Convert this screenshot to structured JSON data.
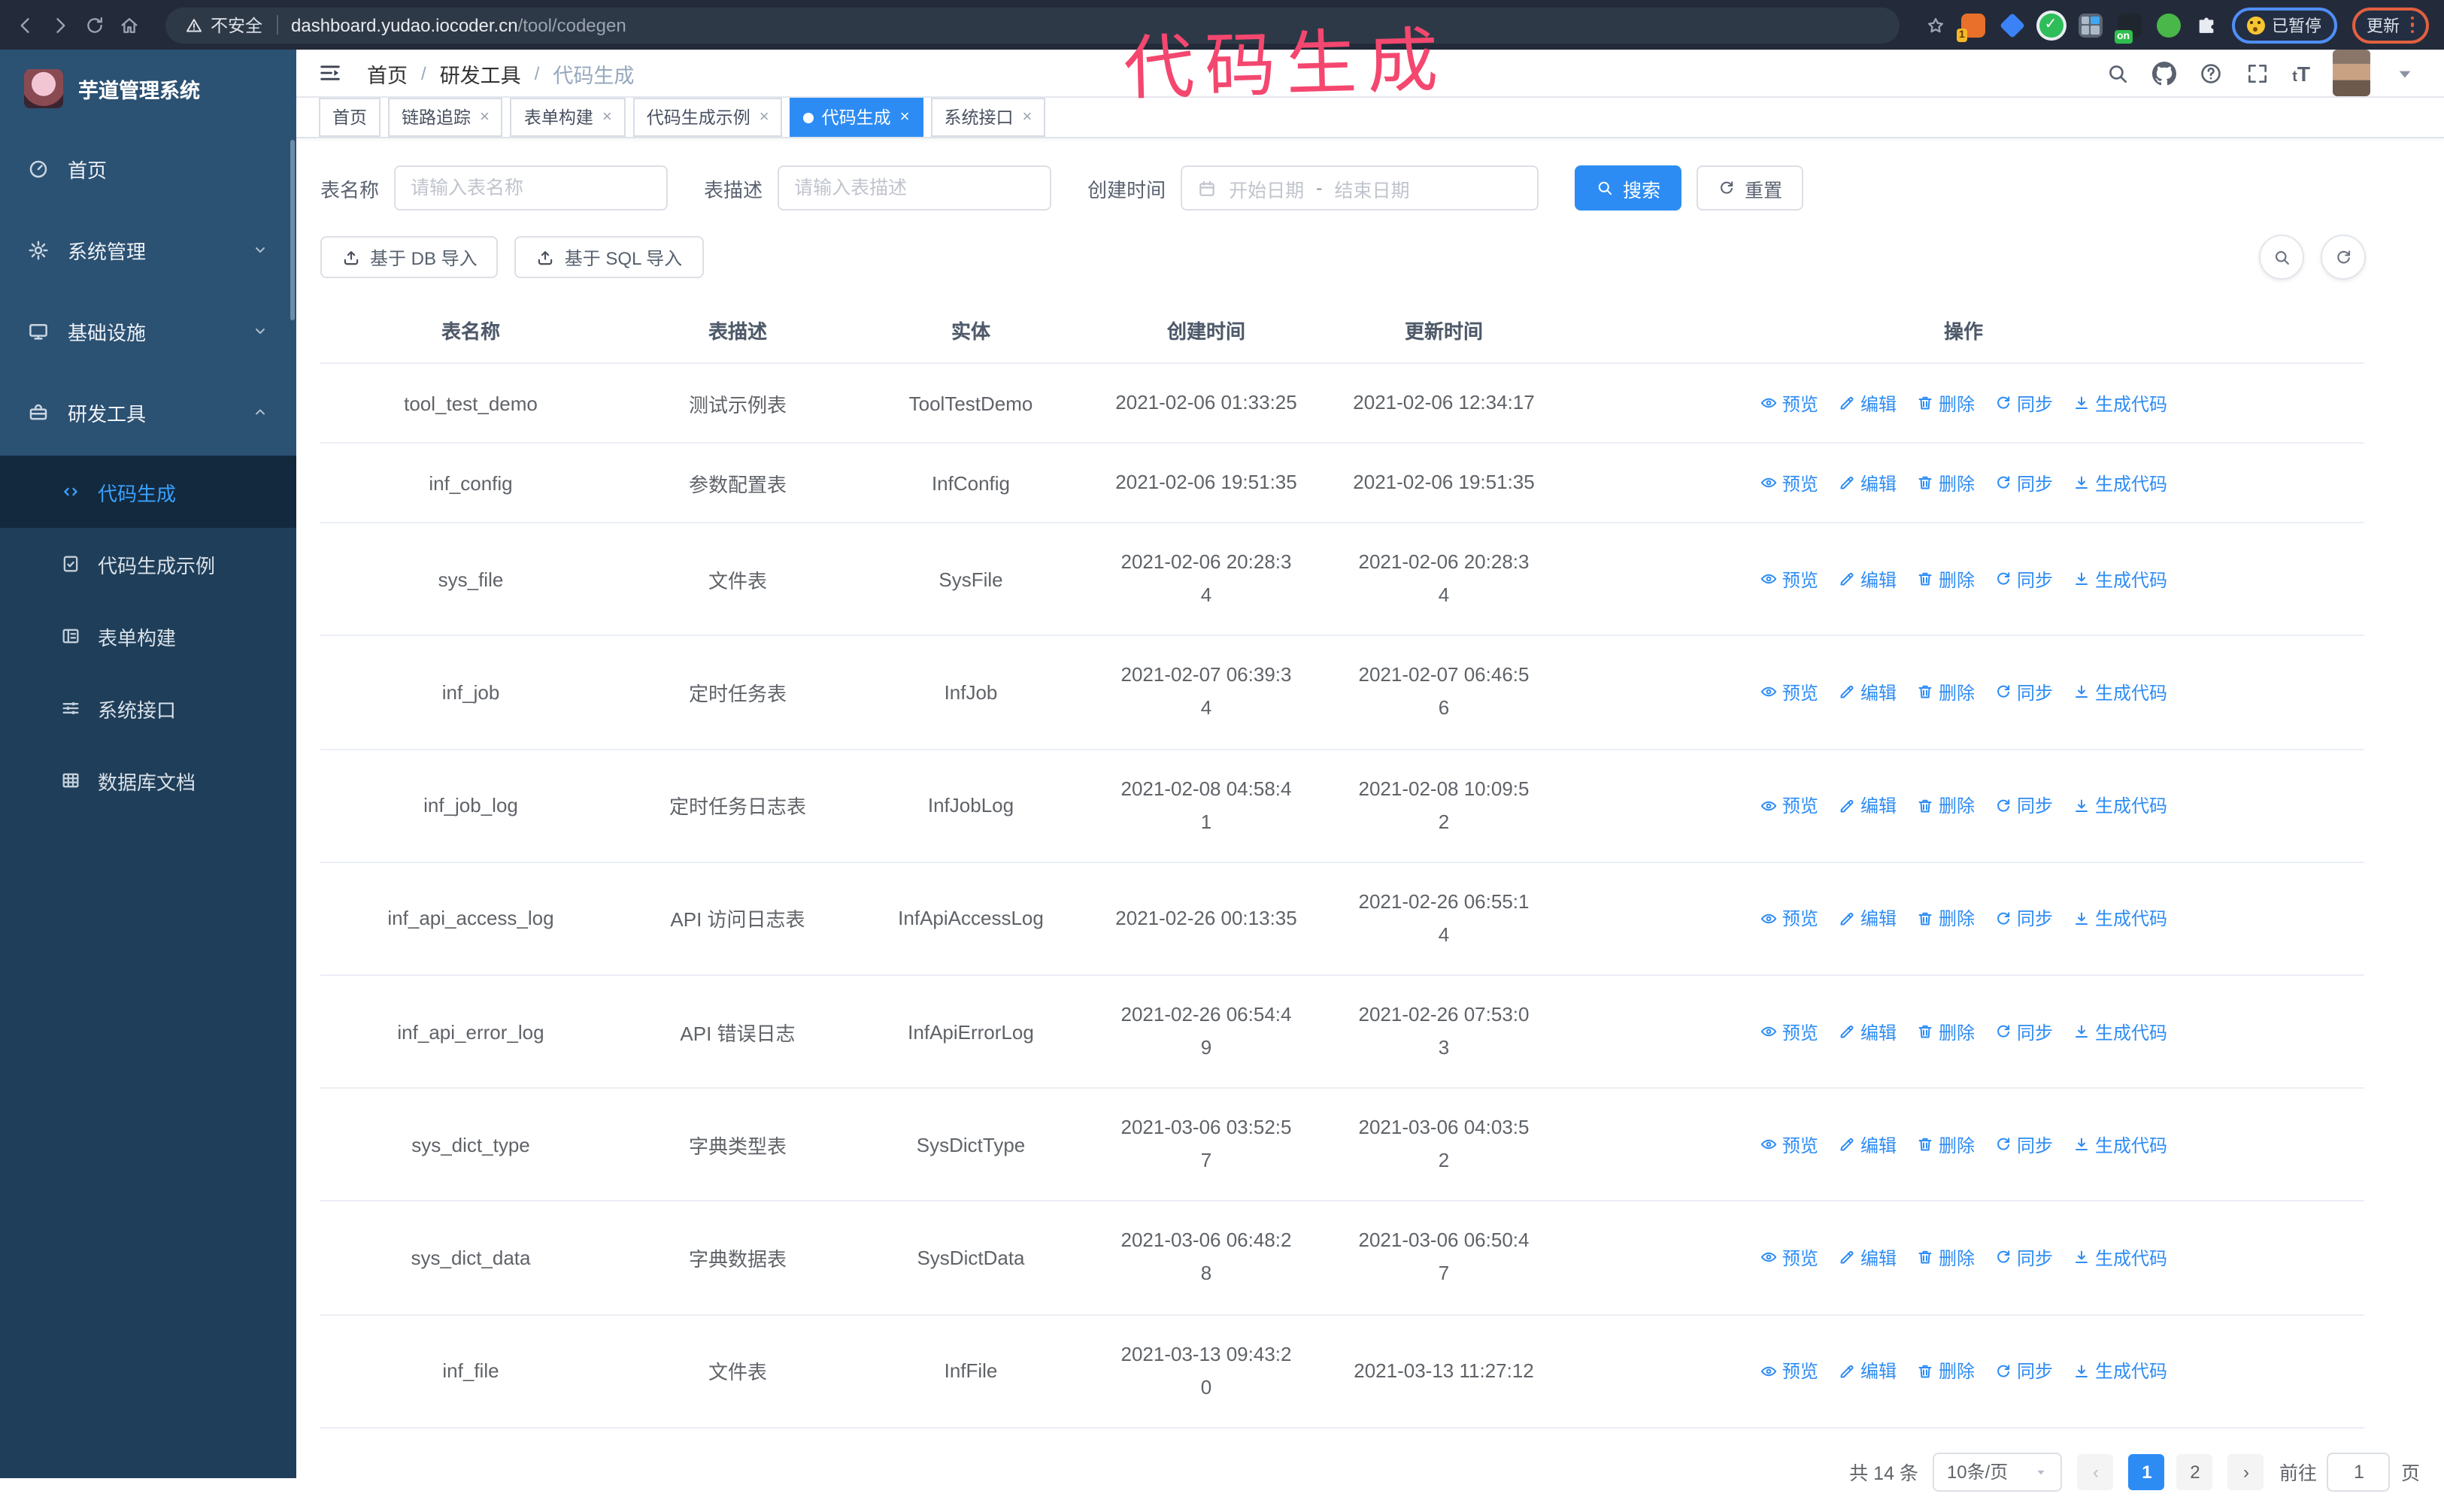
{
  "annotation": {
    "text": "代码生成",
    "color": "#f4476f"
  },
  "browser": {
    "security": "不安全",
    "url_host": "dashboard.yudao.iocoder.cn",
    "url_path": "/tool/codegen",
    "ext_badge": "1",
    "onetab": "on",
    "paused": "已暂停",
    "update": "更新"
  },
  "sidebar": {
    "title": "芋道管理系统",
    "items": [
      {
        "label": "首页",
        "icon": "dashboard-icon",
        "chevron": ""
      },
      {
        "label": "系统管理",
        "icon": "gear-icon",
        "chevron": "down"
      },
      {
        "label": "基础设施",
        "icon": "monitor-icon",
        "chevron": "down"
      },
      {
        "label": "研发工具",
        "icon": "toolbox-icon",
        "chevron": "up"
      }
    ],
    "submenu": [
      {
        "label": "代码生成",
        "icon": "code-icon",
        "active": true
      },
      {
        "label": "代码生成示例",
        "icon": "example-icon",
        "active": false
      },
      {
        "label": "表单构建",
        "icon": "form-icon",
        "active": false
      },
      {
        "label": "系统接口",
        "icon": "api-icon",
        "active": false
      },
      {
        "label": "数据库文档",
        "icon": "database-icon",
        "active": false
      }
    ]
  },
  "header": {
    "breadcrumb": [
      {
        "label": "首页"
      },
      {
        "label": "研发工具"
      },
      {
        "label": "代码生成"
      }
    ]
  },
  "tabs": [
    {
      "label": "首页",
      "closable": false,
      "active": false
    },
    {
      "label": "链路追踪",
      "closable": true,
      "active": false
    },
    {
      "label": "表单构建",
      "closable": true,
      "active": false
    },
    {
      "label": "代码生成示例",
      "closable": true,
      "active": false
    },
    {
      "label": "代码生成",
      "closable": true,
      "active": true
    },
    {
      "label": "系统接口",
      "closable": true,
      "active": false
    }
  ],
  "search": {
    "name_label": "表名称",
    "name_placeholder": "请输入表名称",
    "desc_label": "表描述",
    "desc_placeholder": "请输入表描述",
    "time_label": "创建时间",
    "start_placeholder": "开始日期",
    "range_separator": "-",
    "end_placeholder": "结束日期",
    "search_button": "搜索",
    "reset_button": "重置"
  },
  "toolbar": {
    "import_db": "基于 DB 导入",
    "import_sql": "基于 SQL 导入"
  },
  "table": {
    "columns": [
      "表名称",
      "表描述",
      "实体",
      "创建时间",
      "更新时间",
      "操作"
    ],
    "actions": [
      "预览",
      "编辑",
      "删除",
      "同步",
      "生成代码"
    ],
    "action_icons": [
      "eye-icon",
      "edit-icon",
      "delete-icon",
      "sync-icon",
      "download-icon"
    ],
    "rows": [
      {
        "name": "tool_test_demo",
        "description": "测试示例表",
        "entity": "ToolTestDemo",
        "created": "2021-02-06 01:33:25",
        "updated": "2021-02-06 12:34:17"
      },
      {
        "name": "inf_config",
        "description": "参数配置表",
        "entity": "InfConfig",
        "created": "2021-02-06 19:51:35",
        "updated": "2021-02-06 19:51:35"
      },
      {
        "name": "sys_file",
        "description": "文件表",
        "entity": "SysFile",
        "created": "2021-02-06 20:28:3\n4",
        "updated": "2021-02-06 20:28:3\n4"
      },
      {
        "name": "inf_job",
        "description": "定时任务表",
        "entity": "InfJob",
        "created": "2021-02-07 06:39:3\n4",
        "updated": "2021-02-07 06:46:5\n6"
      },
      {
        "name": "inf_job_log",
        "description": "定时任务日志表",
        "entity": "InfJobLog",
        "created": "2021-02-08 04:58:4\n1",
        "updated": "2021-02-08 10:09:5\n2"
      },
      {
        "name": "inf_api_access_log",
        "description": "API 访问日志表",
        "entity": "InfApiAccessLog",
        "created": "2021-02-26 00:13:35",
        "updated": "2021-02-26 06:55:1\n4"
      },
      {
        "name": "inf_api_error_log",
        "description": "API 错误日志",
        "entity": "InfApiErrorLog",
        "created": "2021-02-26 06:54:4\n9",
        "updated": "2021-02-26 07:53:0\n3"
      },
      {
        "name": "sys_dict_type",
        "description": "字典类型表",
        "entity": "SysDictType",
        "created": "2021-03-06 03:52:5\n7",
        "updated": "2021-03-06 04:03:5\n2"
      },
      {
        "name": "sys_dict_data",
        "description": "字典数据表",
        "entity": "SysDictData",
        "created": "2021-03-06 06:48:2\n8",
        "updated": "2021-03-06 06:50:4\n7"
      },
      {
        "name": "inf_file",
        "description": "文件表",
        "entity": "InfFile",
        "created": "2021-03-13 09:43:2\n0",
        "updated": "2021-03-13 11:27:12"
      }
    ]
  },
  "pagination": {
    "total": "共 14 条",
    "per_page": "10条/页",
    "pages": [
      "1",
      "2"
    ],
    "active_page": "1",
    "goto_label": "前往",
    "goto_value": "1",
    "goto_suffix": "页"
  },
  "colors": {
    "accent": "#2d8cf4",
    "sidebar": "#1f3e59",
    "sidebar_top": "#2b5173",
    "annotation": "#f4476f",
    "chrome": "#232b3a"
  }
}
